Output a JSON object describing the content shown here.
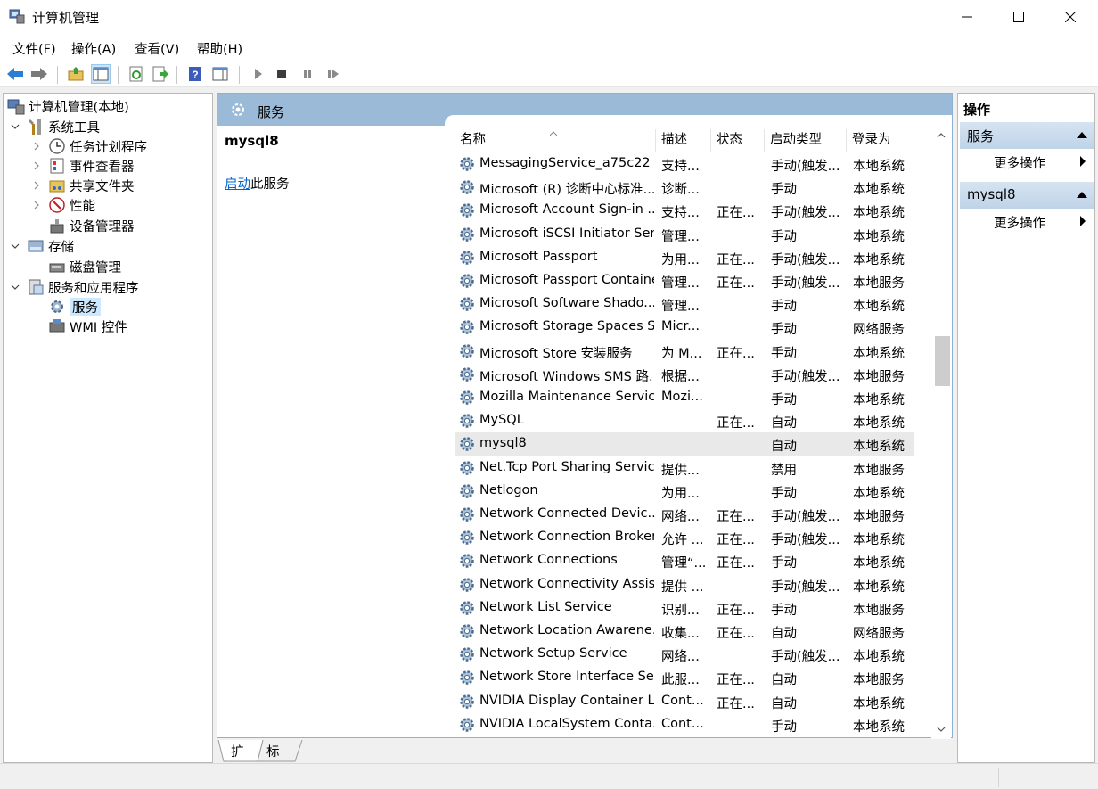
{
  "window": {
    "title": "计算机管理"
  },
  "menu": [
    "文件(F)",
    "操作(A)",
    "查看(V)",
    "帮助(H)"
  ],
  "toolbar": [
    "back-icon",
    "forward-icon",
    "up-folder-icon",
    "show-hide-tree-icon",
    "refresh-icon",
    "export-icon",
    "help-icon",
    "properties-icon",
    "play-icon",
    "stop-icon",
    "pause-icon",
    "restart-icon"
  ],
  "tree": {
    "root": "计算机管理(本地)",
    "system_tools": "系统工具",
    "task_scheduler": "任务计划程序",
    "event_viewer": "事件查看器",
    "shared_folders": "共享文件夹",
    "performance": "性能",
    "device_manager": "设备管理器",
    "storage": "存储",
    "disk_management": "磁盘管理",
    "services_apps": "服务和应用程序",
    "services": "服务",
    "wmi": "WMI 控件"
  },
  "center": {
    "header_title": "服务",
    "selected_service": "mysql8",
    "action_link": "启动",
    "action_suffix": "此服务",
    "columns": {
      "name": "名称",
      "desc": "描述",
      "status": "状态",
      "startup": "启动类型",
      "logon": "登录为"
    },
    "rows": [
      {
        "name": "MessagingService_a75c22",
        "desc": "支持...",
        "status": "",
        "startup": "手动(触发...",
        "logon": "本地系统"
      },
      {
        "name": "Microsoft (R) 诊断中心标准...",
        "desc": "诊断...",
        "status": "",
        "startup": "手动",
        "logon": "本地系统"
      },
      {
        "name": "Microsoft Account Sign-in ...",
        "desc": "支持...",
        "status": "正在...",
        "startup": "手动(触发...",
        "logon": "本地系统"
      },
      {
        "name": "Microsoft iSCSI Initiator Ser...",
        "desc": "管理...",
        "status": "",
        "startup": "手动",
        "logon": "本地系统"
      },
      {
        "name": "Microsoft Passport",
        "desc": "为用...",
        "status": "正在...",
        "startup": "手动(触发...",
        "logon": "本地系统"
      },
      {
        "name": "Microsoft Passport Container",
        "desc": "管理...",
        "status": "正在...",
        "startup": "手动(触发...",
        "logon": "本地服务"
      },
      {
        "name": "Microsoft Software Shado...",
        "desc": "管理...",
        "status": "",
        "startup": "手动",
        "logon": "本地系统"
      },
      {
        "name": "Microsoft Storage Spaces S...",
        "desc": "Micr...",
        "status": "",
        "startup": "手动",
        "logon": "网络服务"
      },
      {
        "name": "Microsoft Store 安装服务",
        "desc": "为 M...",
        "status": "正在...",
        "startup": "手动",
        "logon": "本地系统"
      },
      {
        "name": "Microsoft Windows SMS 路...",
        "desc": "根据...",
        "status": "",
        "startup": "手动(触发...",
        "logon": "本地服务"
      },
      {
        "name": "Mozilla Maintenance Service",
        "desc": "Mozi...",
        "status": "",
        "startup": "手动",
        "logon": "本地系统"
      },
      {
        "name": "MySQL",
        "desc": "",
        "status": "正在...",
        "startup": "自动",
        "logon": "本地系统"
      },
      {
        "name": "mysql8",
        "desc": "",
        "status": "",
        "startup": "自动",
        "logon": "本地系统"
      },
      {
        "name": "Net.Tcp Port Sharing Service",
        "desc": "提供...",
        "status": "",
        "startup": "禁用",
        "logon": "本地服务"
      },
      {
        "name": "Netlogon",
        "desc": "为用...",
        "status": "",
        "startup": "手动",
        "logon": "本地系统"
      },
      {
        "name": "Network Connected Devic...",
        "desc": "网络...",
        "status": "正在...",
        "startup": "手动(触发...",
        "logon": "本地服务"
      },
      {
        "name": "Network Connection Broker",
        "desc": "允许 ...",
        "status": "正在...",
        "startup": "手动(触发...",
        "logon": "本地系统"
      },
      {
        "name": "Network Connections",
        "desc": "管理“...",
        "status": "正在...",
        "startup": "手动",
        "logon": "本地系统"
      },
      {
        "name": "Network Connectivity Assis...",
        "desc": "提供 ...",
        "status": "",
        "startup": "手动(触发...",
        "logon": "本地系统"
      },
      {
        "name": "Network List Service",
        "desc": "识别...",
        "status": "正在...",
        "startup": "手动",
        "logon": "本地服务"
      },
      {
        "name": "Network Location Awarene...",
        "desc": "收集...",
        "status": "正在...",
        "startup": "自动",
        "logon": "网络服务"
      },
      {
        "name": "Network Setup Service",
        "desc": "网络...",
        "status": "",
        "startup": "手动(触发...",
        "logon": "本地系统"
      },
      {
        "name": "Network Store Interface Se...",
        "desc": "此服...",
        "status": "正在...",
        "startup": "自动",
        "logon": "本地服务"
      },
      {
        "name": "NVIDIA Display Container LS",
        "desc": "Cont...",
        "status": "正在...",
        "startup": "自动",
        "logon": "本地系统"
      },
      {
        "name": "NVIDIA LocalSystem Conta...",
        "desc": "Cont...",
        "status": "",
        "startup": "手动",
        "logon": "本地系统"
      }
    ],
    "selected_row_index": 12
  },
  "tabs": {
    "extended": "扩展",
    "standard": "标准"
  },
  "actions": {
    "title": "操作",
    "section1": "服务",
    "section1_more": "更多操作",
    "section2": "mysql8",
    "section2_more": "更多操作"
  },
  "colors": {
    "header_blue": "#9bbad8",
    "link": "#0066cc",
    "section_blue": "#c9dbee"
  }
}
